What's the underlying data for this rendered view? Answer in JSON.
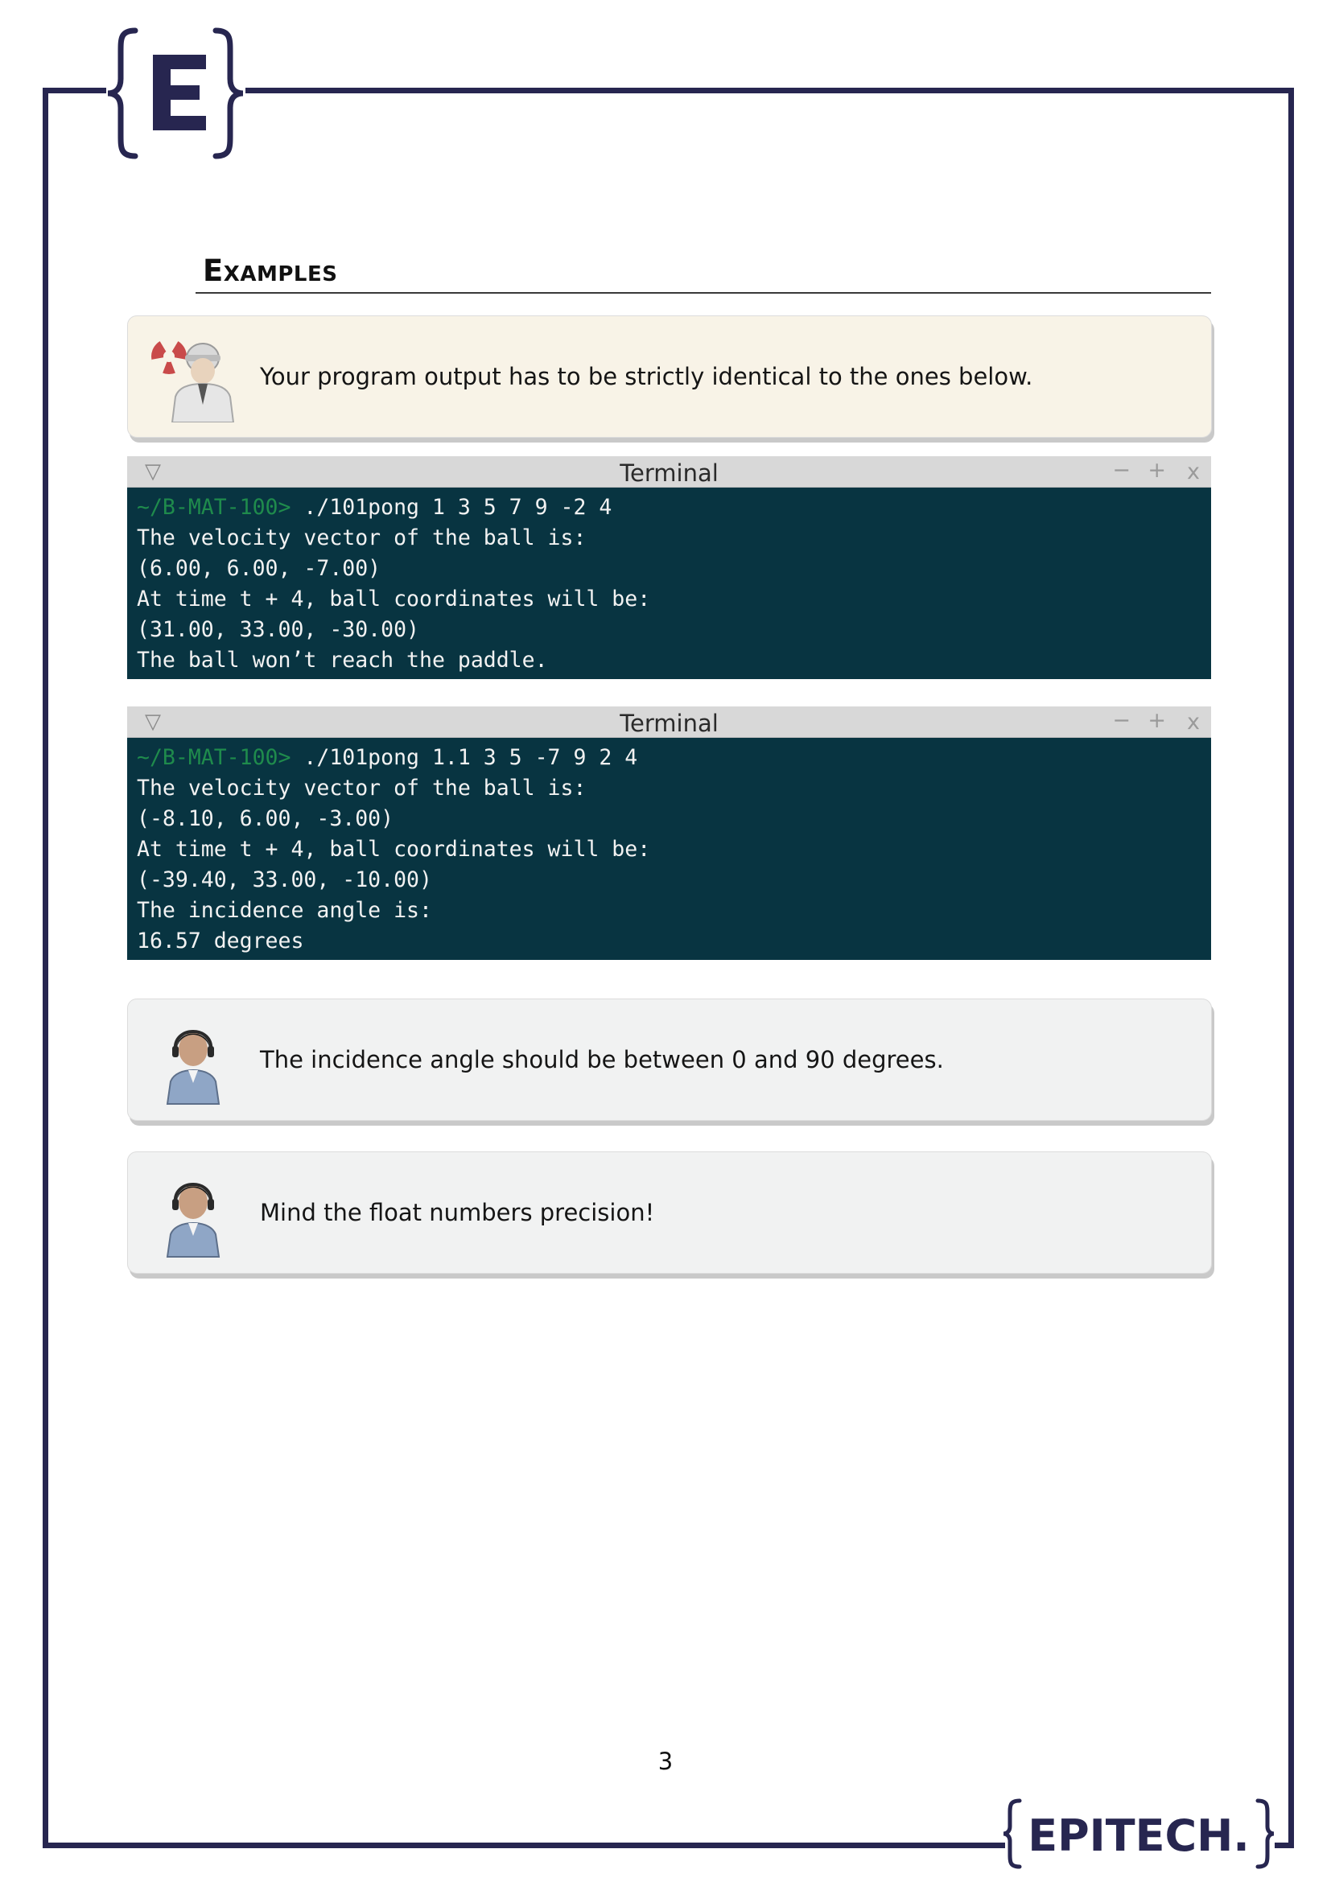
{
  "header": {
    "logo_letter": "E"
  },
  "section": {
    "title": "Examples"
  },
  "notes": {
    "warning": {
      "text": "Your program output has to be strictly identical to the ones below."
    },
    "info_angle": {
      "text": "The incidence angle should be between 0 and 90 degrees."
    },
    "info_precision": {
      "text": "Mind the float numbers precision!"
    }
  },
  "terminals": [
    {
      "title": "Terminal",
      "menu_icon": "▽",
      "controls": {
        "minimize": "−",
        "maximize": "+",
        "close": "x"
      },
      "prompt": "~/B-MAT-100>",
      "command": " ./101pong 1 3 5 7 9 -2 4",
      "output": [
        "The velocity vector of the ball is:",
        "(6.00, 6.00, -7.00)",
        "At time t + 4, ball coordinates will be:",
        "(31.00, 33.00, -30.00)",
        "The ball won’t reach the paddle."
      ]
    },
    {
      "title": "Terminal",
      "menu_icon": "▽",
      "controls": {
        "minimize": "−",
        "maximize": "+",
        "close": "x"
      },
      "prompt": "~/B-MAT-100>",
      "command": " ./101pong 1.1 3 5 -7 9 2 4",
      "output": [
        "The velocity vector of the ball is:",
        "(-8.10, 6.00, -3.00)",
        "At time t + 4, ball coordinates will be:",
        "(-39.40, 33.00, -10.00)",
        "The incidence angle is:",
        "16.57 degrees"
      ]
    }
  ],
  "footer": {
    "page_number": "3",
    "brand": "EPITECH."
  },
  "colors": {
    "frame": "#272650",
    "terminal_bg": "#083441",
    "prompt": "#1f8b4c",
    "warning_bg": "#f8f3e7",
    "info_bg": "#f1f2f2"
  }
}
